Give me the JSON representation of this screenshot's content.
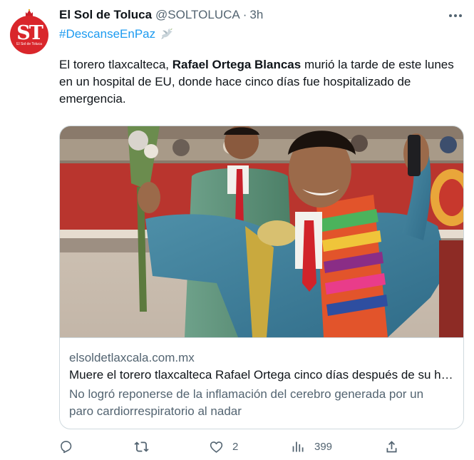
{
  "author": {
    "display_name": "El Sol de Toluca",
    "handle": "@SOLTOLUCA",
    "separator": "·",
    "time": "3h",
    "avatar": {
      "logo_text": "ST",
      "logo_sub": "El Sol de Toluca",
      "color": "#d9262b"
    }
  },
  "tweet": {
    "hashtag": "#DescanseEnPaz",
    "text_before": "El torero tlaxcalteca, ",
    "text_bold": "Rafael Ortega Blancas",
    "text_after": " murió la tarde de este lunes en un hospital de EU, donde hace cinco días fue hospitalizado de emergencia."
  },
  "card": {
    "domain": "elsoldetlaxcala.com.mx",
    "title": "Muere el torero tlaxcalteca Rafael Ortega cinco días después de su hospitalización",
    "description": "No logró reponerse de la inflamación del cerebro generada por un paro cardiorrespiratorio al nadar"
  },
  "actions": {
    "reply": {
      "icon": "reply-icon",
      "count": ""
    },
    "retweet": {
      "icon": "retweet-icon",
      "count": ""
    },
    "like": {
      "icon": "heart-icon",
      "count": "2"
    },
    "views": {
      "icon": "views-icon",
      "count": "399"
    },
    "share": {
      "icon": "share-icon"
    }
  },
  "colors": {
    "accent": "#1d9bf0",
    "muted": "#536471",
    "text": "#0f1419",
    "border": "#cfd9de"
  }
}
